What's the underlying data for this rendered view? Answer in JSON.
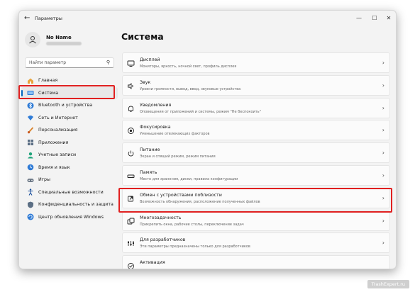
{
  "titlebar": {
    "back_icon": "back-arrow-icon",
    "title": "Параметры",
    "controls": [
      "minimize",
      "maximize",
      "close"
    ]
  },
  "profile": {
    "name": "No Name"
  },
  "search": {
    "placeholder": "Найти параметр"
  },
  "sidebar": {
    "items": [
      {
        "label": "Главная",
        "icon": "home-icon",
        "active": false
      },
      {
        "label": "Система",
        "icon": "system-icon",
        "active": true
      },
      {
        "label": "Bluetooth и устройства",
        "icon": "bluetooth-icon",
        "active": false
      },
      {
        "label": "Сеть и Интернет",
        "icon": "network-icon",
        "active": false
      },
      {
        "label": "Персонализация",
        "icon": "brush-icon",
        "active": false
      },
      {
        "label": "Приложения",
        "icon": "apps-icon",
        "active": false
      },
      {
        "label": "Учетные записи",
        "icon": "accounts-icon",
        "active": false
      },
      {
        "label": "Время и язык",
        "icon": "time-language-icon",
        "active": false
      },
      {
        "label": "Игры",
        "icon": "gaming-icon",
        "active": false
      },
      {
        "label": "Специальные возможности",
        "icon": "accessibility-icon",
        "active": false
      },
      {
        "label": "Конфиденциальность и защита",
        "icon": "shield-icon",
        "active": false
      },
      {
        "label": "Центр обновления Windows",
        "icon": "update-icon",
        "active": false
      }
    ]
  },
  "main": {
    "title": "Система",
    "cards": [
      {
        "title": "Дисплей",
        "subtitle": "Мониторы, яркость, ночной свет, профиль дисплея",
        "icon": "display-icon"
      },
      {
        "title": "Звук",
        "subtitle": "Уровни громкости, вывод, ввод, звуковые устройства",
        "icon": "sound-icon"
      },
      {
        "title": "Уведомления",
        "subtitle": "Оповещения от приложений и системы, режим \"Не беспокоить\"",
        "icon": "bell-icon"
      },
      {
        "title": "Фокусировка",
        "subtitle": "Уменьшение отвлекающих факторов",
        "icon": "focus-icon"
      },
      {
        "title": "Питание",
        "subtitle": "Экран и спящий режим, режим питания",
        "icon": "power-icon"
      },
      {
        "title": "Память",
        "subtitle": "Место для хранения, диски, правила конфигурации",
        "icon": "storage-icon"
      },
      {
        "title": "Обмен с устройствами поблизости",
        "subtitle": "Возможность обнаружения, расположение полученных файлов",
        "icon": "nearby-sharing-icon"
      },
      {
        "title": "Многозадачность",
        "subtitle": "Прикрепить окна, рабочие столы, переключение задач",
        "icon": "multitasking-icon"
      },
      {
        "title": "Для разработчиков",
        "subtitle": "Эти параметры предназначены только для разработчиков",
        "icon": "developer-icon"
      },
      {
        "title": "Активация",
        "subtitle": "",
        "icon": "activation-icon"
      }
    ]
  },
  "watermark": "TrashExpert.ru",
  "colors": {
    "accent": "#0067c0",
    "highlight": "#e02020"
  }
}
